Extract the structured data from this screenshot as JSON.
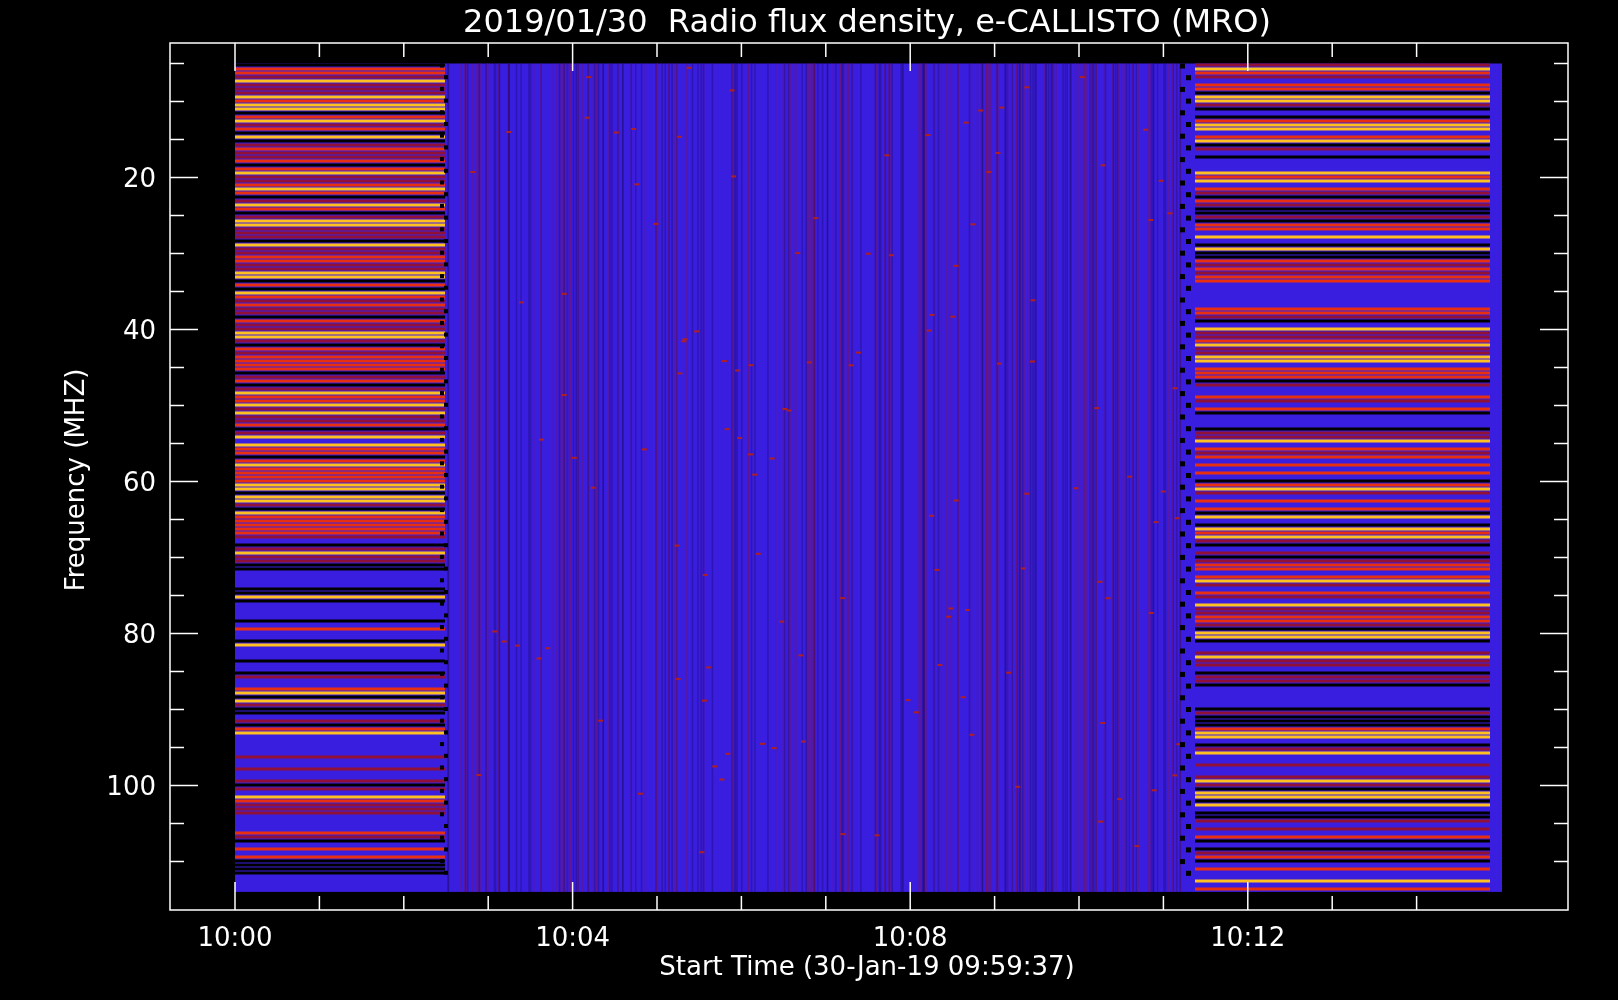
{
  "plot": {
    "title": "2019/01/30  Radio flux density, e-CALLISTO (MRO)",
    "xlabel": "Start Time (30-Jan-19 09:59:37)",
    "ylabel": "Frequency (MHZ)",
    "xtick_labels": [
      "10:00",
      "10:04",
      "10:08",
      "10:12"
    ],
    "ytick_labels": [
      "20",
      "40",
      "60",
      "80",
      "100"
    ]
  }
}
